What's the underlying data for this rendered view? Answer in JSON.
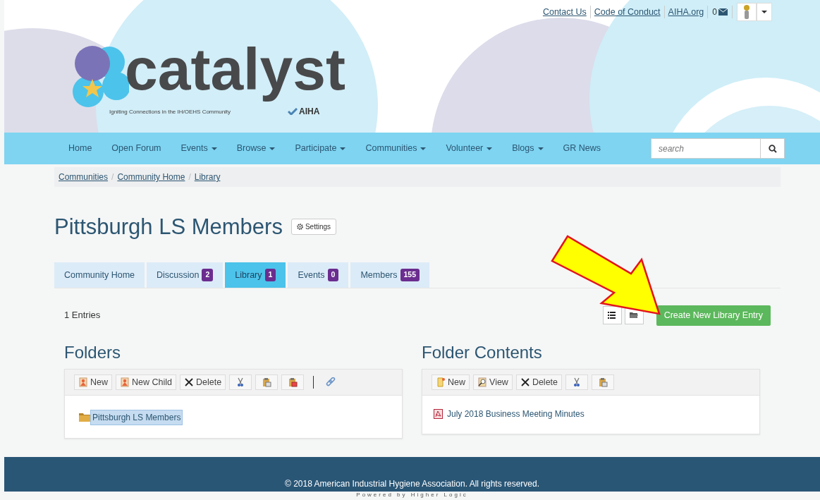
{
  "top_links": [
    {
      "label": "Contact Us"
    },
    {
      "label": "Code of Conduct"
    },
    {
      "label": "AIHA.org"
    }
  ],
  "message_count": "0",
  "logo": {
    "wordmark": "catalyst",
    "tagline": "Igniting Connections in the IH/OEHS Community",
    "org": "AIHA"
  },
  "nav": {
    "items": [
      {
        "label": "Home",
        "dropdown": false
      },
      {
        "label": "Open Forum",
        "dropdown": false
      },
      {
        "label": "Events",
        "dropdown": true
      },
      {
        "label": "Browse",
        "dropdown": true
      },
      {
        "label": "Participate",
        "dropdown": true
      },
      {
        "label": "Communities",
        "dropdown": true
      },
      {
        "label": "Volunteer",
        "dropdown": true
      },
      {
        "label": "Blogs",
        "dropdown": true
      },
      {
        "label": "GR News",
        "dropdown": false
      }
    ],
    "search": {
      "placeholder": "search"
    }
  },
  "breadcrumb": [
    {
      "kind": "link",
      "label": "Communities"
    },
    {
      "kind": "separator",
      "label": "/"
    },
    {
      "kind": "link",
      "label": "Community Home"
    },
    {
      "kind": "separator",
      "label": "/"
    },
    {
      "kind": "link",
      "label": "Library"
    }
  ],
  "page": {
    "title": "Pittsburgh LS Members",
    "settings_button": "Settings"
  },
  "tabs": [
    {
      "label": "Community Home",
      "selected": false
    },
    {
      "label": "Discussion",
      "count": "2",
      "selected": false
    },
    {
      "label": "Library",
      "count": "1",
      "selected": true
    },
    {
      "label": "Events",
      "count": "0",
      "selected": false
    },
    {
      "label": "Members",
      "count": "155",
      "selected": false
    }
  ],
  "entries_count": "1 Entries",
  "view_buttons": [
    {
      "kind": "list"
    },
    {
      "kind": "folder"
    }
  ],
  "create_button": "Create New Library Entry",
  "folders": {
    "heading": "Folders",
    "toolbar": [
      {
        "kind": "new",
        "label": "New"
      },
      {
        "kind": "new_child",
        "label": "New Child"
      },
      {
        "kind": "delete",
        "label": "Delete"
      },
      {
        "kind": "cut"
      },
      {
        "kind": "paste"
      },
      {
        "kind": "paste_special"
      },
      {
        "kind": "separator"
      },
      {
        "kind": "link"
      }
    ],
    "tree": [
      {
        "label": "Pittsburgh LS Members",
        "selected": true
      }
    ]
  },
  "contents": {
    "heading": "Folder Contents",
    "toolbar": [
      {
        "kind": "new_doc",
        "label": "New"
      },
      {
        "kind": "view",
        "label": "View"
      },
      {
        "kind": "delete",
        "label": "Delete"
      },
      {
        "kind": "cut"
      },
      {
        "kind": "paste"
      }
    ],
    "items": [
      {
        "label": "July 2018 Business Meeting Minutes",
        "kind": "pdf"
      }
    ]
  },
  "footer": {
    "copyright": "© 2018 American Industrial Hygiene Association. All rights reserved.",
    "powered_by": "Powered by Higher Logic"
  }
}
